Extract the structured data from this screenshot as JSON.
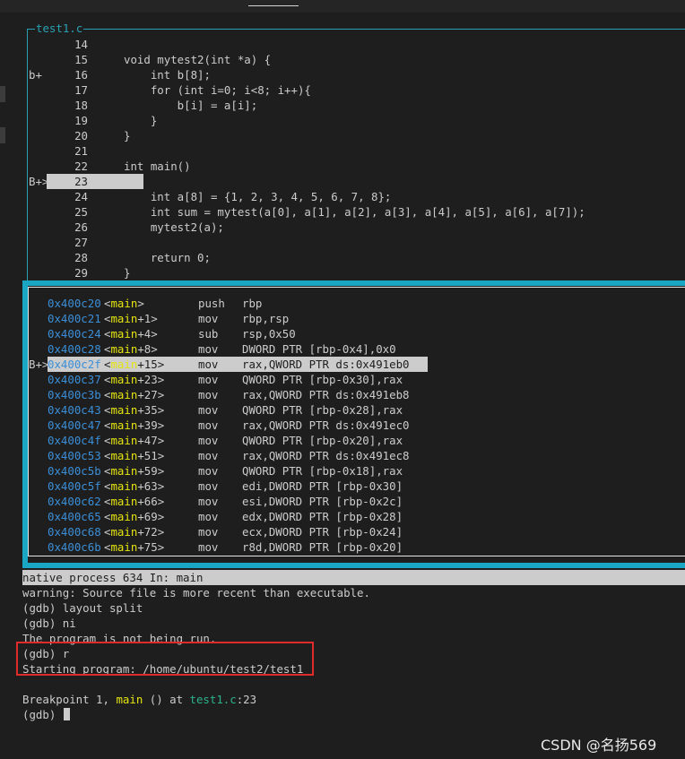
{
  "window": {
    "title": "test1.c"
  },
  "source": {
    "lines": [
      {
        "marker": "",
        "num": "14",
        "code": ""
      },
      {
        "marker": "",
        "num": "15",
        "code": "void mytest2(int *a) {"
      },
      {
        "marker": "b+",
        "num": "16",
        "code": "    int b[8];"
      },
      {
        "marker": "",
        "num": "17",
        "code": "    for (int i=0; i<8; i++){"
      },
      {
        "marker": "",
        "num": "18",
        "code": "        b[i] = a[i];"
      },
      {
        "marker": "",
        "num": "19",
        "code": "    }"
      },
      {
        "marker": "",
        "num": "20",
        "code": "}"
      },
      {
        "marker": "",
        "num": "21",
        "code": ""
      },
      {
        "marker": "",
        "num": "22",
        "code": "int main()"
      },
      {
        "marker": "B+>",
        "num": "23",
        "code": "{"
      },
      {
        "marker": "",
        "num": "24",
        "code": "    int a[8] = {1, 2, 3, 4, 5, 6, 7, 8};"
      },
      {
        "marker": "",
        "num": "25",
        "code": "    int sum = mytest(a[0], a[1], a[2], a[3], a[4], a[5], a[6], a[7]);"
      },
      {
        "marker": "",
        "num": "26",
        "code": "    mytest2(a);"
      },
      {
        "marker": "",
        "num": "27",
        "code": ""
      },
      {
        "marker": "",
        "num": "28",
        "code": "    return 0;"
      },
      {
        "marker": "",
        "num": "29",
        "code": "}"
      }
    ]
  },
  "asm": {
    "lines": [
      {
        "marker": "",
        "addr": "0x400c20",
        "fn": "main",
        "off": ">",
        "op": "push",
        "args": "rbp"
      },
      {
        "marker": "",
        "addr": "0x400c21",
        "fn": "main",
        "off": "+1>",
        "op": "mov",
        "args": "rbp,rsp"
      },
      {
        "marker": "",
        "addr": "0x400c24",
        "fn": "main",
        "off": "+4>",
        "op": "sub",
        "args": "rsp,0x50"
      },
      {
        "marker": "",
        "addr": "0x400c28",
        "fn": "main",
        "off": "+8>",
        "op": "mov",
        "args": "DWORD PTR [rbp-0x4],0x0"
      },
      {
        "marker": "B+>",
        "addr": "0x400c2f",
        "fn": "main",
        "off": "+15>",
        "op": "mov",
        "args": "rax,QWORD PTR ds:0x491eb0"
      },
      {
        "marker": "",
        "addr": "0x400c37",
        "fn": "main",
        "off": "+23>",
        "op": "mov",
        "args": "QWORD PTR [rbp-0x30],rax"
      },
      {
        "marker": "",
        "addr": "0x400c3b",
        "fn": "main",
        "off": "+27>",
        "op": "mov",
        "args": "rax,QWORD PTR ds:0x491eb8"
      },
      {
        "marker": "",
        "addr": "0x400c43",
        "fn": "main",
        "off": "+35>",
        "op": "mov",
        "args": "QWORD PTR [rbp-0x28],rax"
      },
      {
        "marker": "",
        "addr": "0x400c47",
        "fn": "main",
        "off": "+39>",
        "op": "mov",
        "args": "rax,QWORD PTR ds:0x491ec0"
      },
      {
        "marker": "",
        "addr": "0x400c4f",
        "fn": "main",
        "off": "+47>",
        "op": "mov",
        "args": "QWORD PTR [rbp-0x20],rax"
      },
      {
        "marker": "",
        "addr": "0x400c53",
        "fn": "main",
        "off": "+51>",
        "op": "mov",
        "args": "rax,QWORD PTR ds:0x491ec8"
      },
      {
        "marker": "",
        "addr": "0x400c5b",
        "fn": "main",
        "off": "+59>",
        "op": "mov",
        "args": "QWORD PTR [rbp-0x18],rax"
      },
      {
        "marker": "",
        "addr": "0x400c5f",
        "fn": "main",
        "off": "+63>",
        "op": "mov",
        "args": "edi,DWORD PTR [rbp-0x30]"
      },
      {
        "marker": "",
        "addr": "0x400c62",
        "fn": "main",
        "off": "+66>",
        "op": "mov",
        "args": "esi,DWORD PTR [rbp-0x2c]"
      },
      {
        "marker": "",
        "addr": "0x400c65",
        "fn": "main",
        "off": "+69>",
        "op": "mov",
        "args": "edx,DWORD PTR [rbp-0x28]"
      },
      {
        "marker": "",
        "addr": "0x400c68",
        "fn": "main",
        "off": "+72>",
        "op": "mov",
        "args": "ecx,DWORD PTR [rbp-0x24]"
      },
      {
        "marker": "",
        "addr": "0x400c6b",
        "fn": "main",
        "off": "+75>",
        "op": "mov",
        "args": "r8d,DWORD PTR [rbp-0x20]"
      }
    ]
  },
  "status": {
    "text": "native process 634 In: main"
  },
  "console": {
    "l1": "warning: Source file is more recent than executable.",
    "l2": "(gdb) layout split",
    "l3": "(gdb) ni",
    "l4": "The program is not being run.",
    "l5": "(gdb) r",
    "l6": "Starting program: /home/ubuntu/test2/test1",
    "bp_prefix": "Breakpoint 1, ",
    "bp_fn": "main",
    "bp_mid": " () at ",
    "bp_file": "test1.c",
    "bp_line": ":23",
    "prompt": "(gdb) "
  },
  "watermark": "CSDN @名扬569",
  "colors": {
    "frame": "#1aa7c4",
    "address": "#3b8fd8",
    "function": "#e5e510",
    "file": "#2bb38a",
    "highlight_box": "#e02b2b"
  }
}
